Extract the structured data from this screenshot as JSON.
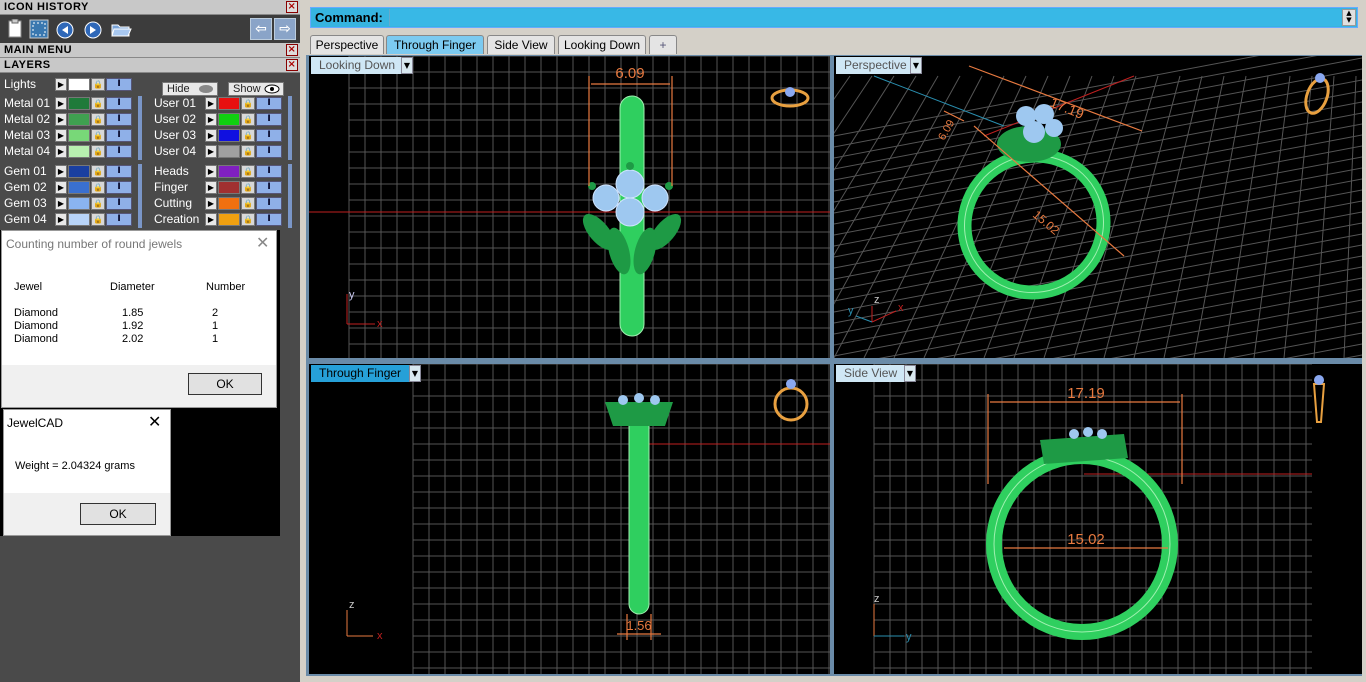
{
  "panels": {
    "icon_history": "ICON HISTORY",
    "main_menu": "MAIN MENU",
    "layers": "LAYERS",
    "close_glyph": "×"
  },
  "layers": {
    "lights_label": "Lights",
    "hide_label": "Hide",
    "show_label": "Show",
    "left_column": [
      {
        "label": "Metal 01",
        "color": "#1f7a3a"
      },
      {
        "label": "Metal 02",
        "color": "#3fa050"
      },
      {
        "label": "Metal 03",
        "color": "#78d878"
      },
      {
        "label": "Metal 04",
        "color": "#b8f0b0"
      },
      {
        "label": "Gem 01",
        "color": "#1a3fa0"
      },
      {
        "label": "Gem 02",
        "color": "#3a70d0"
      },
      {
        "label": "Gem 03",
        "color": "#8ab4f0"
      },
      {
        "label": "Gem 04",
        "color": "#b8d4f8"
      }
    ],
    "right_column": [
      {
        "label": "User 01",
        "color": "#e81010"
      },
      {
        "label": "User 02",
        "color": "#10d010"
      },
      {
        "label": "User 03",
        "color": "#1010e0"
      },
      {
        "label": "User 04",
        "color": "#a0a0a0"
      },
      {
        "label": "Heads",
        "color": "#8020c0"
      },
      {
        "label": "Finger",
        "color": "#a03030"
      },
      {
        "label": "Cutting",
        "color": "#f07010"
      },
      {
        "label": "Creation",
        "color": "#f0a010"
      }
    ]
  },
  "jewel_dialog": {
    "title": "Counting number of round jewels",
    "columns": [
      "Jewel",
      "Diameter",
      "Number"
    ],
    "rows": [
      {
        "jewel": "Diamond",
        "diameter": "1.85",
        "number": "2"
      },
      {
        "jewel": "Diamond",
        "diameter": "1.92",
        "number": "1"
      },
      {
        "jewel": "Diamond",
        "diameter": "2.02",
        "number": "1"
      }
    ],
    "ok_label": "OK"
  },
  "weight_dialog": {
    "title": "JewelCAD",
    "message": "Weight = 2.04324 grams",
    "ok_label": "OK"
  },
  "command": {
    "label": "Command:",
    "value": ""
  },
  "tabs": [
    {
      "label": "Perspective",
      "active": false
    },
    {
      "label": "Through Finger",
      "active": true
    },
    {
      "label": "Side View",
      "active": false
    },
    {
      "label": "Looking Down",
      "active": false
    },
    {
      "label": "+",
      "active": false
    }
  ],
  "viewports": {
    "top_left": {
      "label": "Looking Down",
      "dim_value": "6.09",
      "axis_v": "y",
      "axis_h": "x"
    },
    "top_right": {
      "label": "Perspective",
      "dim_width": "17.19",
      "dim_inner": "15.02",
      "dim_small": "6.09",
      "axis_v": "z",
      "axis_h": "x",
      "axis_y": "y"
    },
    "bottom_left": {
      "label": "Through Finger",
      "dim_value": "1.56",
      "axis_v": "z",
      "axis_h": "x"
    },
    "bottom_right": {
      "label": "Side View",
      "dim_width": "17.19",
      "dim_inner": "15.02",
      "axis_v": "z",
      "axis_h": "y"
    }
  },
  "colors": {
    "ring_green": "#2fcf5f",
    "gem_blue": "#9ec8f0",
    "dimension": "#e87a40",
    "grid": "#555555",
    "ref_red": "#c02020"
  }
}
